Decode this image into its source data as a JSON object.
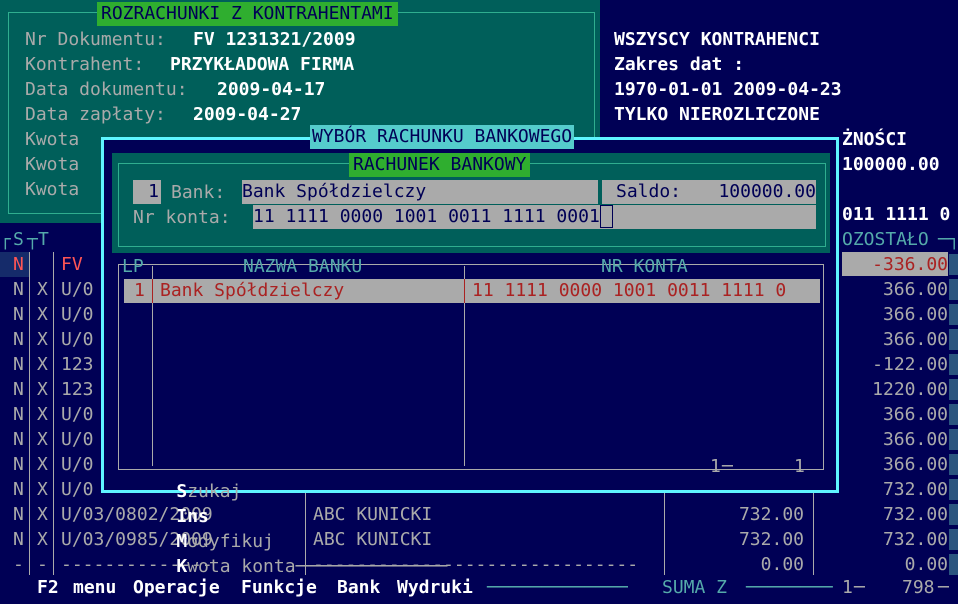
{
  "header": {
    "title": "ROZRACHUNKI  Z  KONTRAHENTAMI",
    "doc_label": "Nr Dokumentu:",
    "doc_value": "FV 1231321/2009",
    "contractor_label": "Kontrahent:",
    "contractor_value": "PRZYKŁADOWA FIRMA",
    "doc_date_label": "Data dokumentu:",
    "doc_date_value": "2009-04-17",
    "pay_date_label": "Data zapłaty:",
    "pay_date_value": "2009-04-27",
    "amount_label_1": "Kwota",
    "amount_label_2": "Kwota",
    "amount_label_3": "Kwota"
  },
  "filter": {
    "line1": "WSZYSCY KONTRAHENCI",
    "line2": "Zakres dat :",
    "line3": "1970-01-01 2009-04-23",
    "line4": "TYLKO NIEROZLICZONE",
    "line5": "ŻNOŚCI",
    "line6": "100000.00",
    "line7": "011 1111 0"
  },
  "dialog": {
    "title": "WYBÓR RACHUNKU BANKOWEGO",
    "section_title": "RACHUNEK BANKOWY",
    "num": "1",
    "bank_label": "Bank:",
    "bank_value": "Bank Spółdzielczy",
    "saldo_label": "Saldo:",
    "saldo_value": "100000.00",
    "account_label": "Nr konta:",
    "account_value": "11 1111 0000 1001 0011 1111 0001",
    "columns": {
      "lp": "LP",
      "name": "NAZWA BANKU",
      "account": "NR KONTA"
    },
    "rows": [
      {
        "lp": "1",
        "name": "Bank Spółdzielczy",
        "account": "11 1111 0000 1001 0011 1111 0"
      }
    ],
    "footer": {
      "search_key": "S",
      "search_rest": "zukaj",
      "ins_key": "Ins",
      "modify_key": "M",
      "modify_rest": "odyfikuj",
      "amount_key": "K",
      "amount_rest": "wota konta",
      "count_a": "1",
      "count_b": "1"
    }
  },
  "table": {
    "col_s": "S",
    "col_t": "T",
    "col_remaining": "OZOSTAŁO",
    "rows": [
      {
        "s": "N",
        "t": "",
        "doc": "FV",
        "name": "",
        "amount": "",
        "remaining": "-336.00"
      },
      {
        "s": "N",
        "t": "X",
        "doc": "U/0",
        "name": "",
        "amount": "",
        "remaining": "366.00"
      },
      {
        "s": "N",
        "t": "X",
        "doc": "U/0",
        "name": "",
        "amount": "",
        "remaining": "366.00"
      },
      {
        "s": "N",
        "t": "X",
        "doc": "U/0",
        "name": "",
        "amount": "",
        "remaining": "366.00"
      },
      {
        "s": "N",
        "t": "X",
        "doc": "123",
        "name": "",
        "amount": "",
        "remaining": "-122.00"
      },
      {
        "s": "N",
        "t": "X",
        "doc": "123",
        "name": "",
        "amount": "",
        "remaining": "1220.00"
      },
      {
        "s": "N",
        "t": "X",
        "doc": "U/0",
        "name": "",
        "amount": "",
        "remaining": "366.00"
      },
      {
        "s": "N",
        "t": "X",
        "doc": "U/0",
        "name": "",
        "amount": "",
        "remaining": "366.00"
      },
      {
        "s": "N",
        "t": "X",
        "doc": "U/0",
        "name": "",
        "amount": "",
        "remaining": "366.00"
      },
      {
        "s": "N",
        "t": "X",
        "doc": "U/0",
        "name": "",
        "amount": "",
        "remaining": "732.00"
      },
      {
        "s": "N",
        "t": "X",
        "doc": "U/03/0802/2009",
        "name": "ABC KUNICKI",
        "amount": "732.00",
        "remaining": "732.00"
      },
      {
        "s": "N",
        "t": "X",
        "doc": "U/03/0985/2009",
        "name": "ABC KUNICKI",
        "amount": "732.00",
        "remaining": "732.00"
      },
      {
        "s": "-",
        "t": "-",
        "doc": "--------------",
        "name": "------------------------------",
        "amount": "0.00",
        "remaining": "0.00"
      }
    ]
  },
  "menubar": {
    "f2": "F2",
    "menu": "menu",
    "operations": "Operacje",
    "functions": "Funkcje",
    "bank": "Bank",
    "prints": "Wydruki",
    "sum_label": "SUMA Z",
    "count": "1",
    "total": "798"
  }
}
